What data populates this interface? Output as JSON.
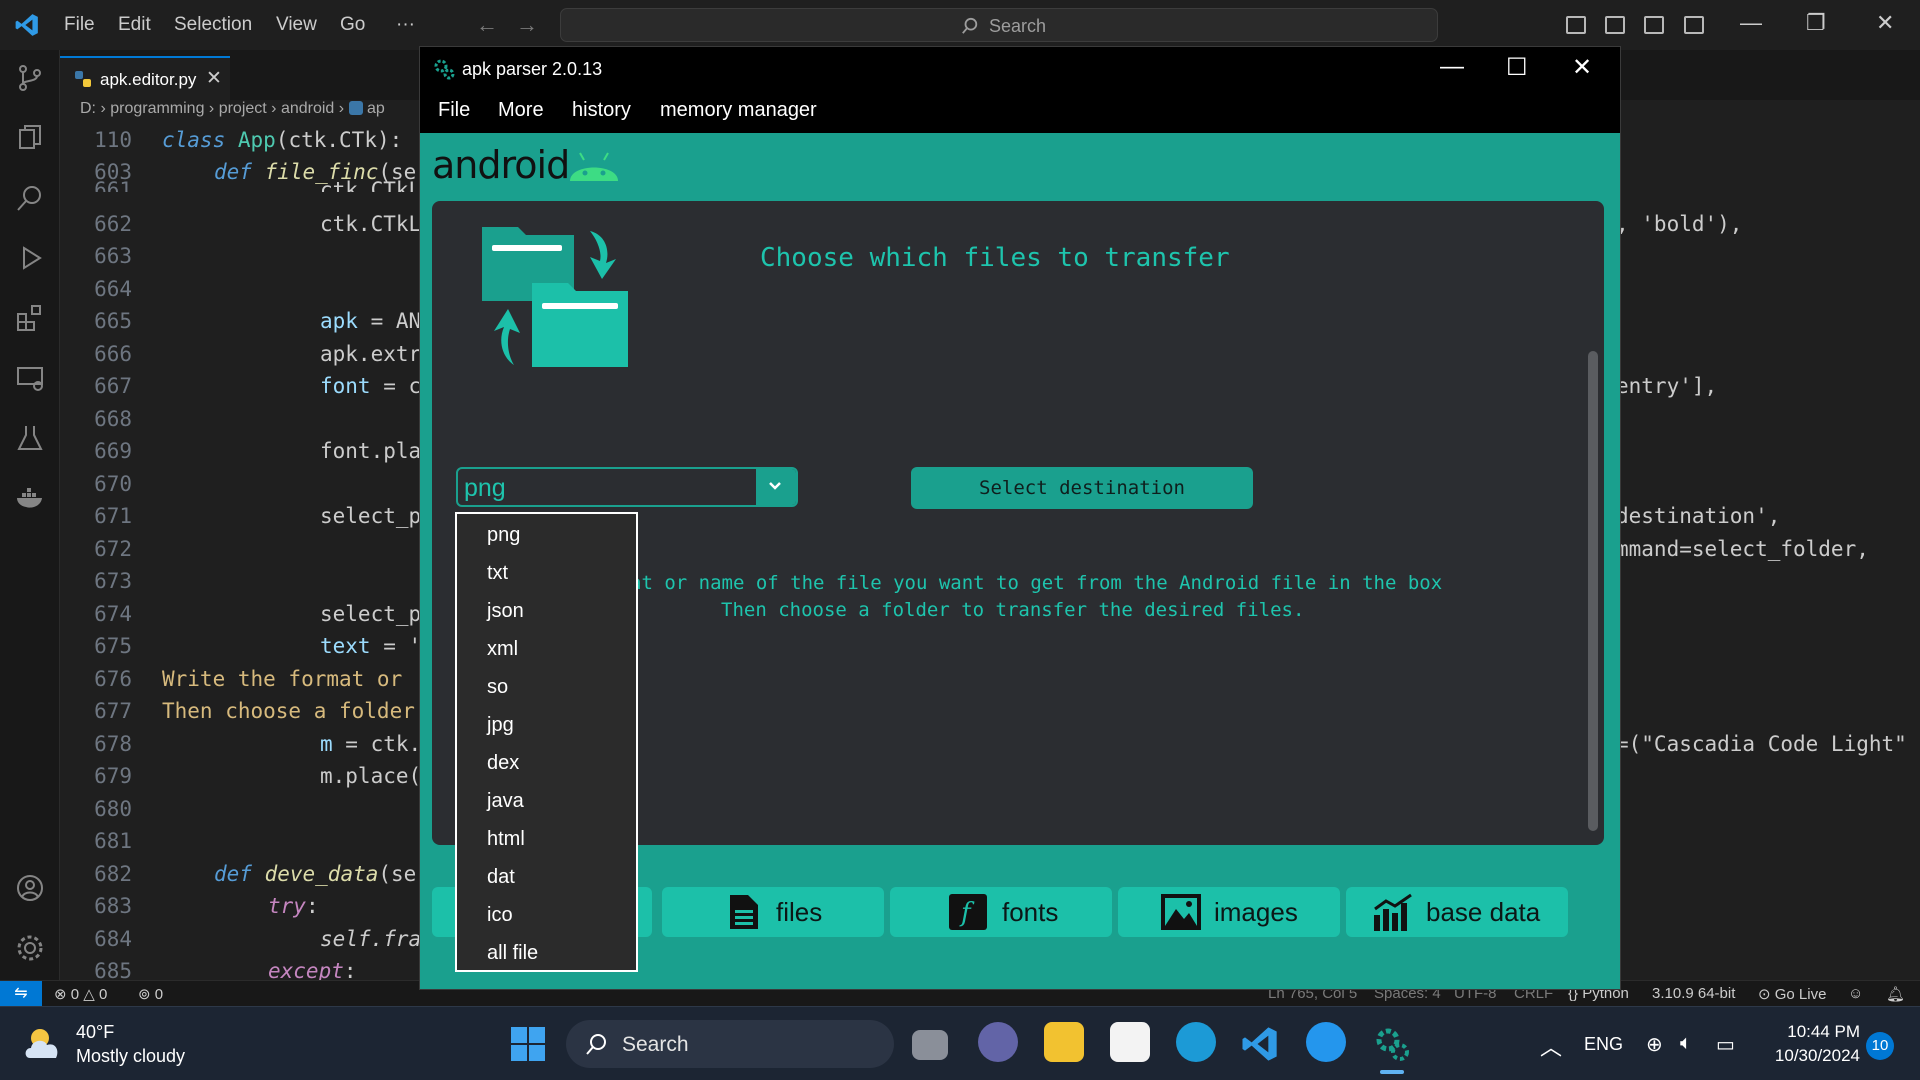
{
  "vscode": {
    "menu": [
      "File",
      "Edit",
      "Selection",
      "View",
      "Go",
      "···"
    ],
    "search_placeholder": "Search",
    "tab_name": "apk.editor.py",
    "breadcrumb": "D: › programming › project › android › ",
    "breadcrumb_tail": "ap",
    "line_numbers": [
      "110",
      "603",
      "661",
      "662",
      "663",
      "664",
      "665",
      "666",
      "667",
      "668",
      "669",
      "670",
      "671",
      "672",
      "673",
      "674",
      "675",
      "676",
      "677",
      "678",
      "679",
      "680",
      "681",
      "682",
      "683",
      "684",
      "685"
    ],
    "code_left": {
      "l110_kw": "class",
      "l110_cls": "App",
      "l110_rest": "(ctk.CTk):",
      "l603_kw": "def",
      "l603_fn": "file_finc",
      "l603_rest": "(se",
      "l661": "ctk.CTkL",
      "l662": "ctk.CTkL",
      "l665_a": "apk",
      "l665_b": " = AN",
      "l666": "apk.extr",
      "l667_a": "font",
      "l667_b": " = c",
      "l669": "font.pla",
      "l671": "select_p",
      "l674": "select_p",
      "l675_a": "text",
      "l675_b": " = '",
      "l676": "Write the format or",
      "l677": "Then choose a folder",
      "l678_a": "m",
      "l678_b": " = ctk.",
      "l679": "m.place(",
      "l682_kw": "def",
      "l682_fn": "deve_data",
      "l682_rest": "(se",
      "l683_kw": "try",
      "l684": "self.fra",
      "l685_kw": "except"
    },
    "code_right": {
      "r662": ", 'bold'),",
      "r667": "entry'],",
      "r671": "destination',",
      "r672": "mmand=select_folder,",
      "r678": "=(\"Cascadia Code Light\""
    },
    "status": {
      "errors": "0",
      "warnings": "0",
      "ports": "0",
      "position": "Ln 765, Col 5",
      "spaces": "Spaces: 4",
      "encoding": "UTF-8",
      "eol": "CRLF",
      "language": "Python",
      "interpreter": "3.10.9 64-bit",
      "golive": "Go Live"
    }
  },
  "taskbar": {
    "weather_temp": "40°F",
    "weather_desc": "Mostly cloudy",
    "search_label": "Search",
    "lang": "ENG",
    "time": "10:44 PM",
    "date": "10/30/2024",
    "notifications": "10"
  },
  "apk": {
    "title": "apk parser 2.0.13",
    "menu": [
      "File",
      "More",
      "history",
      "memory manager"
    ],
    "brand": "android",
    "heading": "Choose which files to transfer",
    "format_value": "png",
    "dest_button": "Select destination",
    "instr_line1": "at or name of the file you want to get from the Android file in the box",
    "instr_line2": "Then choose a folder to transfer the desired files.",
    "nav": [
      "files",
      "fonts",
      "images",
      "base data"
    ],
    "dropdown_options": [
      "png",
      "txt",
      "json",
      "xml",
      "so",
      "jpg",
      "dex",
      "java",
      "html",
      "dat",
      "ico",
      "all file"
    ],
    "colors": {
      "accent": "#1aa08e",
      "panel": "#2b2d31",
      "text_accent": "#1ec4ad"
    }
  }
}
